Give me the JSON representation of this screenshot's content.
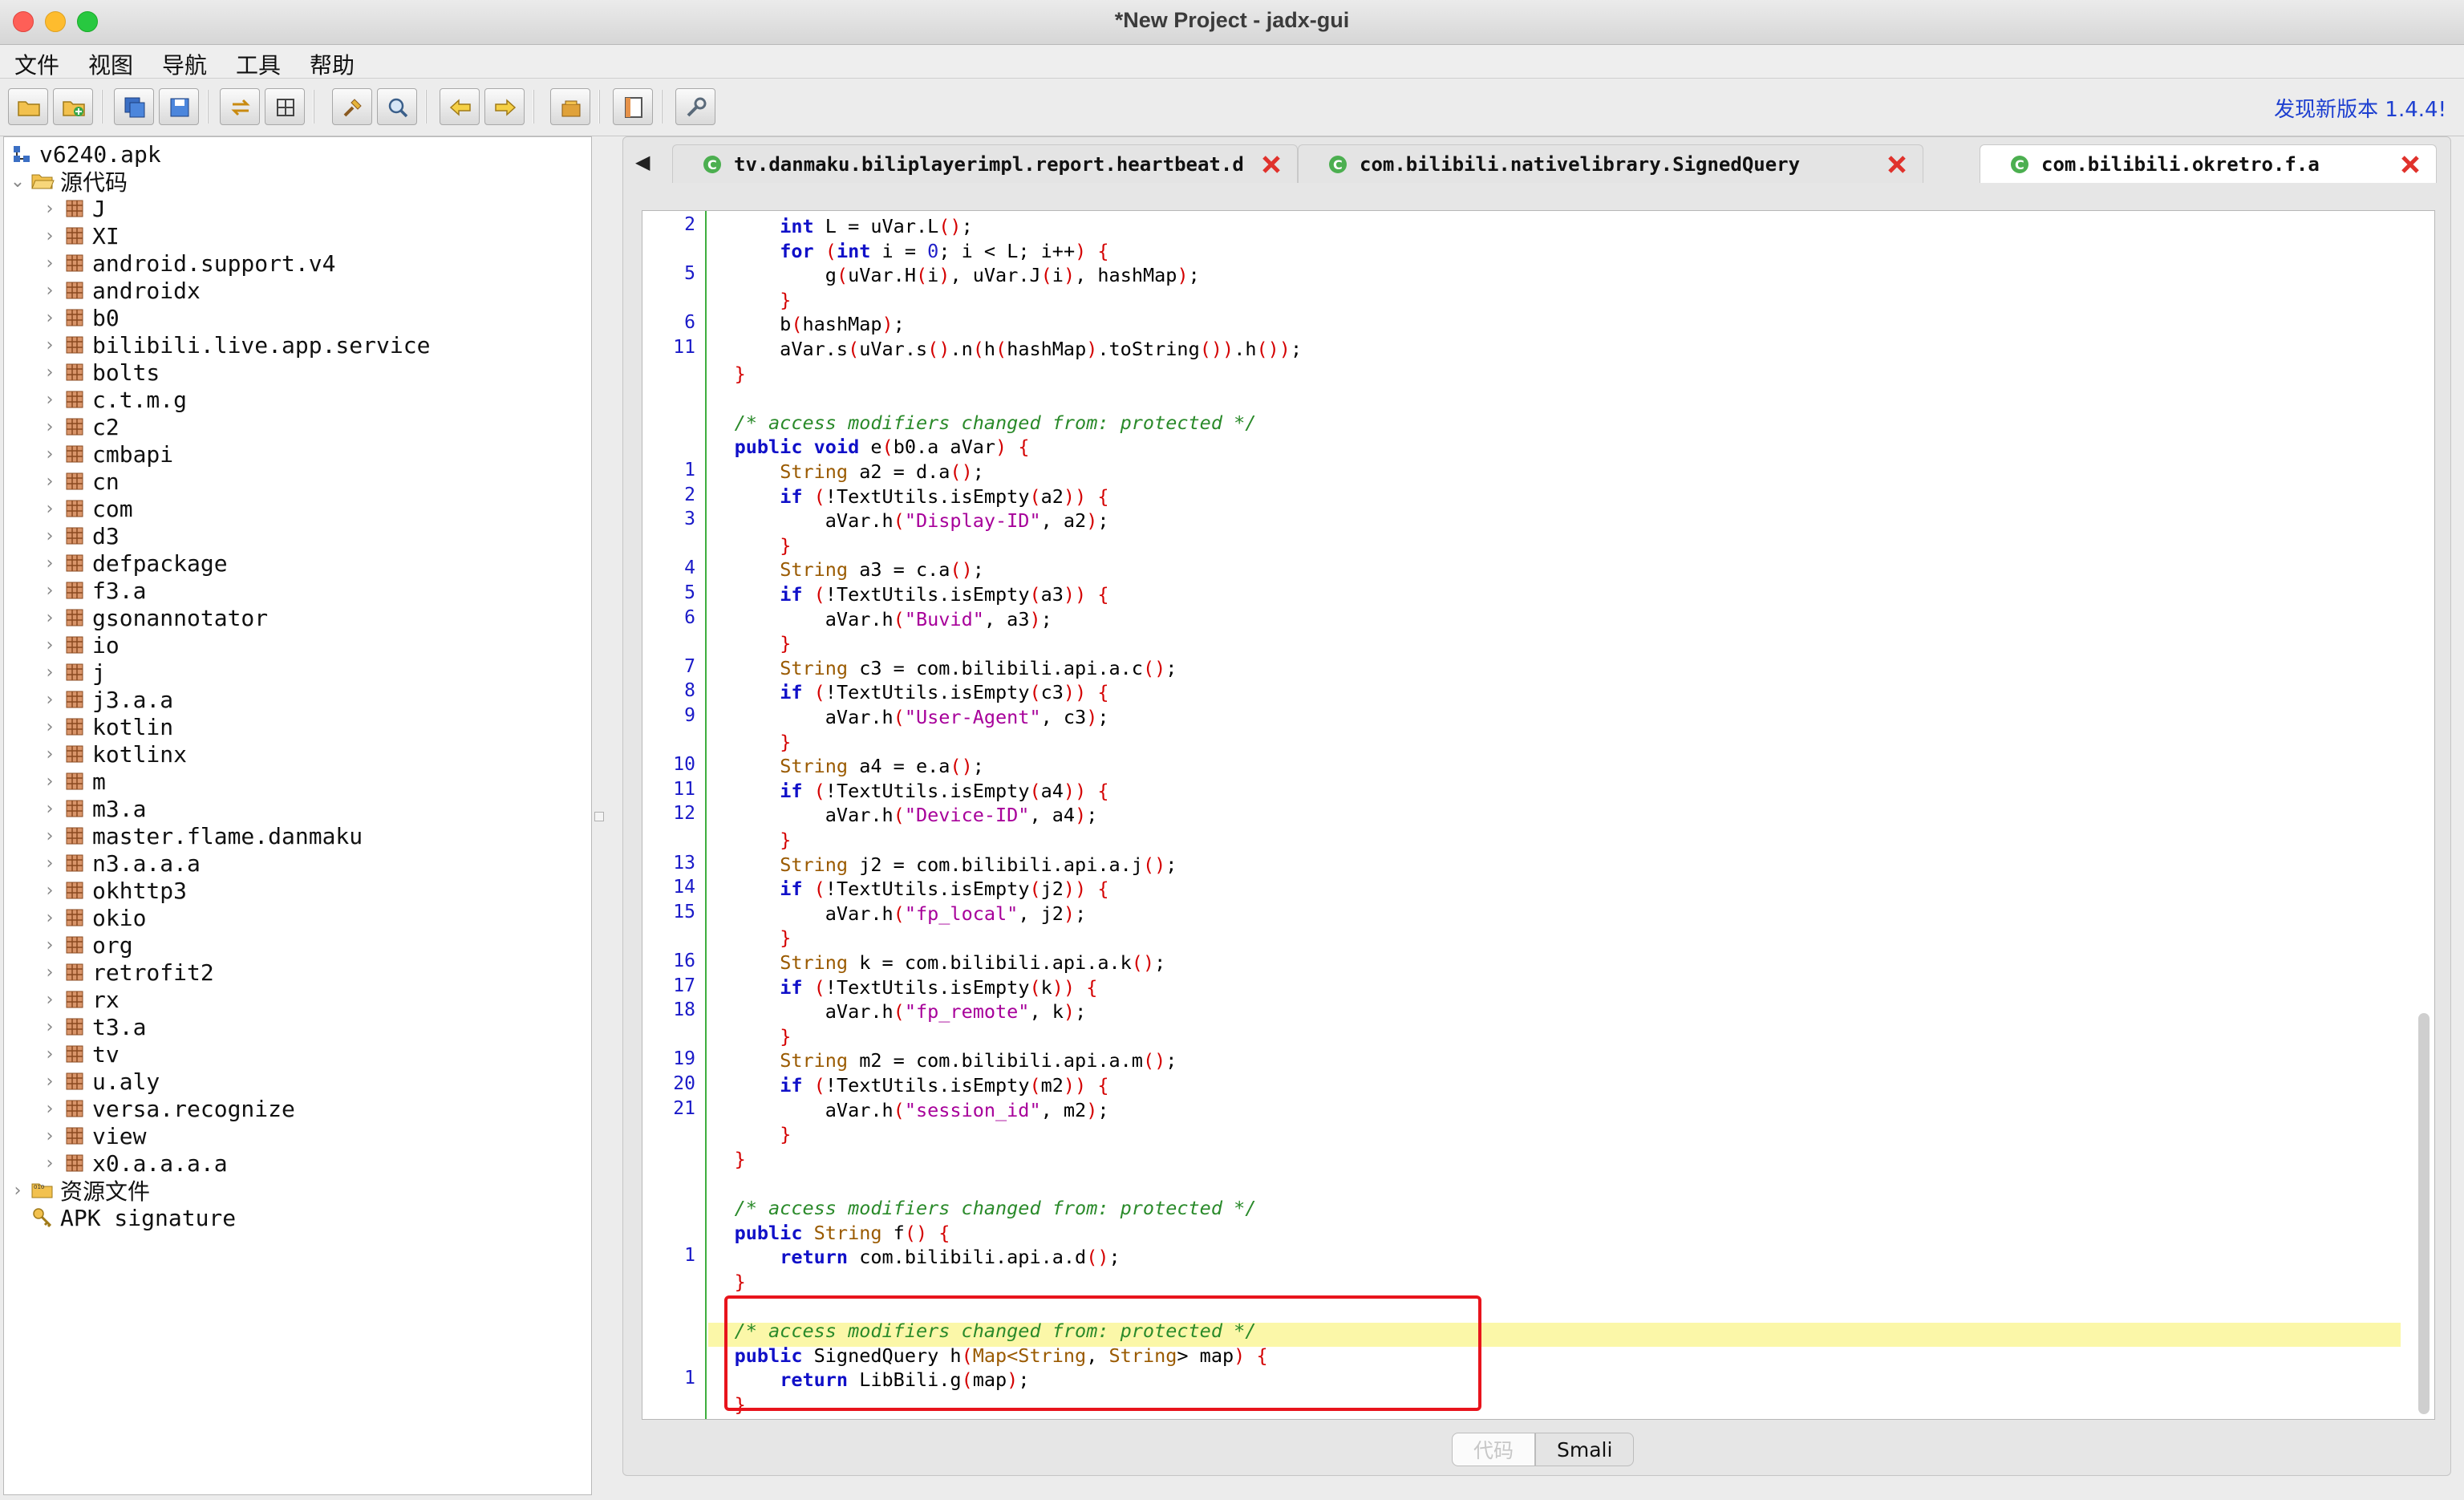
{
  "window": {
    "title": "*New Project - jadx-gui"
  },
  "menu": [
    "文件",
    "视图",
    "导航",
    "工具",
    "帮助"
  ],
  "toolbar": {
    "buttons": [
      "open-file-icon",
      "add-files-icon",
      "save-all-icon",
      "export-icon",
      "sync-icon",
      "flatten-icon",
      "search-icon",
      "find-class-icon",
      "back-icon",
      "forward-icon",
      "decompile-icon",
      "log-icon",
      "preferences-icon"
    ],
    "update_text": "发现新版本 1.4.4!"
  },
  "tree": {
    "root": "v6240.apk",
    "source_folder": "源代码",
    "packages": [
      "J",
      "XI",
      "android.support.v4",
      "androidx",
      "b0",
      "bilibili.live.app.service",
      "bolts",
      "c.t.m.g",
      "c2",
      "cmbapi",
      "cn",
      "com",
      "d3",
      "defpackage",
      "f3.a",
      "gsonannotator",
      "io",
      "j",
      "j3.a.a",
      "kotlin",
      "kotlinx",
      "m",
      "m3.a",
      "master.flame.danmaku",
      "n3.a.a.a",
      "okhttp3",
      "okio",
      "org",
      "retrofit2",
      "rx",
      "t3.a",
      "tv",
      "u.aly",
      "versa.recognize",
      "view",
      "x0.a.a.a.a"
    ],
    "resources": "资源文件",
    "signature": "APK signature"
  },
  "tabs": [
    {
      "label": "tv.danmaku.biliplayerimpl.report.heartbeat.d",
      "active": false
    },
    {
      "label": "com.bilibili.nativelibrary.SignedQuery",
      "active": false
    },
    {
      "label": "com.bilibili.okretro.f.a",
      "active": true
    }
  ],
  "code": {
    "line_numbers": [
      {
        "row": 0,
        "n": "2"
      },
      {
        "row": 2,
        "n": "5"
      },
      {
        "row": 4,
        "n": "6"
      },
      {
        "row": 5,
        "n": "11"
      },
      {
        "row": 10,
        "n": "1"
      },
      {
        "row": 11,
        "n": "2"
      },
      {
        "row": 12,
        "n": "3"
      },
      {
        "row": 14,
        "n": "4"
      },
      {
        "row": 15,
        "n": "5"
      },
      {
        "row": 16,
        "n": "6"
      },
      {
        "row": 18,
        "n": "7"
      },
      {
        "row": 19,
        "n": "8"
      },
      {
        "row": 20,
        "n": "9"
      },
      {
        "row": 22,
        "n": "10"
      },
      {
        "row": 23,
        "n": "11"
      },
      {
        "row": 24,
        "n": "12"
      },
      {
        "row": 26,
        "n": "13"
      },
      {
        "row": 27,
        "n": "14"
      },
      {
        "row": 28,
        "n": "15"
      },
      {
        "row": 30,
        "n": "16"
      },
      {
        "row": 31,
        "n": "17"
      },
      {
        "row": 32,
        "n": "18"
      },
      {
        "row": 34,
        "n": "19"
      },
      {
        "row": 35,
        "n": "20"
      },
      {
        "row": 36,
        "n": "21"
      },
      {
        "row": 42,
        "n": "1"
      },
      {
        "row": 47,
        "n": "1"
      }
    ],
    "lines": [
      [
        [
          "        ",
          ""
        ],
        [
          "int",
          "kw"
        ],
        [
          " L = uVar.L",
          ""
        ],
        [
          "()",
          "br"
        ],
        [
          ";",
          ""
        ]
      ],
      [
        [
          "        ",
          ""
        ],
        [
          "for",
          "kw"
        ],
        [
          " ",
          ""
        ],
        [
          "(",
          "br"
        ],
        [
          "int",
          "kw"
        ],
        [
          " i = ",
          ""
        ],
        [
          "0",
          "nm"
        ],
        [
          "; i < L; i++",
          ""
        ],
        [
          ")",
          "br"
        ],
        [
          " ",
          ""
        ],
        [
          "{",
          "br"
        ]
      ],
      [
        [
          "            g",
          ""
        ],
        [
          "(",
          "br"
        ],
        [
          "uVar.H",
          ""
        ],
        [
          "(",
          "br"
        ],
        [
          "i",
          ""
        ],
        [
          ")",
          "br"
        ],
        [
          ", uVar.J",
          ""
        ],
        [
          "(",
          "br"
        ],
        [
          "i",
          ""
        ],
        [
          ")",
          "br"
        ],
        [
          ", hashMap",
          ""
        ],
        [
          ")",
          "br"
        ],
        [
          ";",
          ""
        ]
      ],
      [
        [
          "        ",
          ""
        ],
        [
          "}",
          "br"
        ]
      ],
      [
        [
          "        b",
          ""
        ],
        [
          "(",
          "br"
        ],
        [
          "hashMap",
          ""
        ],
        [
          ")",
          "br"
        ],
        [
          ";",
          ""
        ]
      ],
      [
        [
          "        aVar.s",
          ""
        ],
        [
          "(",
          "br"
        ],
        [
          "uVar.s",
          ""
        ],
        [
          "()",
          "br"
        ],
        [
          ".n",
          ""
        ],
        [
          "(",
          "br"
        ],
        [
          "h",
          ""
        ],
        [
          "(",
          "br"
        ],
        [
          "hashMap",
          ""
        ],
        [
          ")",
          "br"
        ],
        [
          ".toString",
          ""
        ],
        [
          "())",
          "br"
        ],
        [
          ".h",
          ""
        ],
        [
          "())",
          "br"
        ],
        [
          ";",
          ""
        ]
      ],
      [
        [
          "    ",
          ""
        ],
        [
          "}",
          "br"
        ]
      ],
      [
        [
          "",
          ""
        ]
      ],
      [
        [
          "    ",
          ""
        ],
        [
          "/* access modifiers changed from: protected */",
          "cm"
        ]
      ],
      [
        [
          "    ",
          ""
        ],
        [
          "public",
          "kw"
        ],
        [
          " ",
          ""
        ],
        [
          "void",
          "kw"
        ],
        [
          " e",
          ""
        ],
        [
          "(",
          "br"
        ],
        [
          "b0.a aVar",
          ""
        ],
        [
          ")",
          "br"
        ],
        [
          " ",
          ""
        ],
        [
          "{",
          "br"
        ]
      ],
      [
        [
          "        ",
          ""
        ],
        [
          "String",
          "ty"
        ],
        [
          " a2 = d.a",
          ""
        ],
        [
          "()",
          "br"
        ],
        [
          ";",
          ""
        ]
      ],
      [
        [
          "        ",
          ""
        ],
        [
          "if",
          "kw"
        ],
        [
          " ",
          ""
        ],
        [
          "(",
          "br"
        ],
        [
          "!TextUtils.isEmpty",
          ""
        ],
        [
          "(",
          "br"
        ],
        [
          "a2",
          ""
        ],
        [
          ")",
          "br"
        ],
        [
          ")",
          "br"
        ],
        [
          " ",
          ""
        ],
        [
          "{",
          "br"
        ]
      ],
      [
        [
          "            aVar.h",
          ""
        ],
        [
          "(",
          "br"
        ],
        [
          "\"Display-ID\"",
          "st"
        ],
        [
          ", a2",
          ""
        ],
        [
          ")",
          "br"
        ],
        [
          ";",
          ""
        ]
      ],
      [
        [
          "        ",
          ""
        ],
        [
          "}",
          "br"
        ]
      ],
      [
        [
          "        ",
          ""
        ],
        [
          "String",
          "ty"
        ],
        [
          " a3 = c.a",
          ""
        ],
        [
          "()",
          "br"
        ],
        [
          ";",
          ""
        ]
      ],
      [
        [
          "        ",
          ""
        ],
        [
          "if",
          "kw"
        ],
        [
          " ",
          ""
        ],
        [
          "(",
          "br"
        ],
        [
          "!TextUtils.isEmpty",
          ""
        ],
        [
          "(",
          "br"
        ],
        [
          "a3",
          ""
        ],
        [
          ")",
          "br"
        ],
        [
          ")",
          "br"
        ],
        [
          " ",
          ""
        ],
        [
          "{",
          "br"
        ]
      ],
      [
        [
          "            aVar.h",
          ""
        ],
        [
          "(",
          "br"
        ],
        [
          "\"Buvid\"",
          "st"
        ],
        [
          ", a3",
          ""
        ],
        [
          ")",
          "br"
        ],
        [
          ";",
          ""
        ]
      ],
      [
        [
          "        ",
          ""
        ],
        [
          "}",
          "br"
        ]
      ],
      [
        [
          "        ",
          ""
        ],
        [
          "String",
          "ty"
        ],
        [
          " c3 = com.bilibili.api.a.c",
          ""
        ],
        [
          "()",
          "br"
        ],
        [
          ";",
          ""
        ]
      ],
      [
        [
          "        ",
          ""
        ],
        [
          "if",
          "kw"
        ],
        [
          " ",
          ""
        ],
        [
          "(",
          "br"
        ],
        [
          "!TextUtils.isEmpty",
          ""
        ],
        [
          "(",
          "br"
        ],
        [
          "c3",
          ""
        ],
        [
          ")",
          "br"
        ],
        [
          ")",
          "br"
        ],
        [
          " ",
          ""
        ],
        [
          "{",
          "br"
        ]
      ],
      [
        [
          "            aVar.h",
          ""
        ],
        [
          "(",
          "br"
        ],
        [
          "\"User-Agent\"",
          "st"
        ],
        [
          ", c3",
          ""
        ],
        [
          ")",
          "br"
        ],
        [
          ";",
          ""
        ]
      ],
      [
        [
          "        ",
          ""
        ],
        [
          "}",
          "br"
        ]
      ],
      [
        [
          "        ",
          ""
        ],
        [
          "String",
          "ty"
        ],
        [
          " a4 = e.a",
          ""
        ],
        [
          "()",
          "br"
        ],
        [
          ";",
          ""
        ]
      ],
      [
        [
          "        ",
          ""
        ],
        [
          "if",
          "kw"
        ],
        [
          " ",
          ""
        ],
        [
          "(",
          "br"
        ],
        [
          "!TextUtils.isEmpty",
          ""
        ],
        [
          "(",
          "br"
        ],
        [
          "a4",
          ""
        ],
        [
          ")",
          "br"
        ],
        [
          ")",
          "br"
        ],
        [
          " ",
          ""
        ],
        [
          "{",
          "br"
        ]
      ],
      [
        [
          "            aVar.h",
          ""
        ],
        [
          "(",
          "br"
        ],
        [
          "\"Device-ID\"",
          "st"
        ],
        [
          ", a4",
          ""
        ],
        [
          ")",
          "br"
        ],
        [
          ";",
          ""
        ]
      ],
      [
        [
          "        ",
          ""
        ],
        [
          "}",
          "br"
        ]
      ],
      [
        [
          "        ",
          ""
        ],
        [
          "String",
          "ty"
        ],
        [
          " j2 = com.bilibili.api.a.j",
          ""
        ],
        [
          "()",
          "br"
        ],
        [
          ";",
          ""
        ]
      ],
      [
        [
          "        ",
          ""
        ],
        [
          "if",
          "kw"
        ],
        [
          " ",
          ""
        ],
        [
          "(",
          "br"
        ],
        [
          "!TextUtils.isEmpty",
          ""
        ],
        [
          "(",
          "br"
        ],
        [
          "j2",
          ""
        ],
        [
          ")",
          "br"
        ],
        [
          ")",
          "br"
        ],
        [
          " ",
          ""
        ],
        [
          "{",
          "br"
        ]
      ],
      [
        [
          "            aVar.h",
          ""
        ],
        [
          "(",
          "br"
        ],
        [
          "\"fp_local\"",
          "st"
        ],
        [
          ", j2",
          ""
        ],
        [
          ")",
          "br"
        ],
        [
          ";",
          ""
        ]
      ],
      [
        [
          "        ",
          ""
        ],
        [
          "}",
          "br"
        ]
      ],
      [
        [
          "        ",
          ""
        ],
        [
          "String",
          "ty"
        ],
        [
          " k = com.bilibili.api.a.k",
          ""
        ],
        [
          "()",
          "br"
        ],
        [
          ";",
          ""
        ]
      ],
      [
        [
          "        ",
          ""
        ],
        [
          "if",
          "kw"
        ],
        [
          " ",
          ""
        ],
        [
          "(",
          "br"
        ],
        [
          "!TextUtils.isEmpty",
          ""
        ],
        [
          "(",
          "br"
        ],
        [
          "k",
          ""
        ],
        [
          ")",
          "br"
        ],
        [
          ")",
          "br"
        ],
        [
          " ",
          ""
        ],
        [
          "{",
          "br"
        ]
      ],
      [
        [
          "            aVar.h",
          ""
        ],
        [
          "(",
          "br"
        ],
        [
          "\"fp_remote\"",
          "st"
        ],
        [
          ", k",
          ""
        ],
        [
          ")",
          "br"
        ],
        [
          ";",
          ""
        ]
      ],
      [
        [
          "        ",
          ""
        ],
        [
          "}",
          "br"
        ]
      ],
      [
        [
          "        ",
          ""
        ],
        [
          "String",
          "ty"
        ],
        [
          " m2 = com.bilibili.api.a.m",
          ""
        ],
        [
          "()",
          "br"
        ],
        [
          ";",
          ""
        ]
      ],
      [
        [
          "        ",
          ""
        ],
        [
          "if",
          "kw"
        ],
        [
          " ",
          ""
        ],
        [
          "(",
          "br"
        ],
        [
          "!TextUtils.isEmpty",
          ""
        ],
        [
          "(",
          "br"
        ],
        [
          "m2",
          ""
        ],
        [
          ")",
          "br"
        ],
        [
          ")",
          "br"
        ],
        [
          " ",
          ""
        ],
        [
          "{",
          "br"
        ]
      ],
      [
        [
          "            aVar.h",
          ""
        ],
        [
          "(",
          "br"
        ],
        [
          "\"session_id\"",
          "st"
        ],
        [
          ", m2",
          ""
        ],
        [
          ")",
          "br"
        ],
        [
          ";",
          ""
        ]
      ],
      [
        [
          "        ",
          ""
        ],
        [
          "}",
          "br"
        ]
      ],
      [
        [
          "    ",
          ""
        ],
        [
          "}",
          "br"
        ]
      ],
      [
        [
          "",
          ""
        ]
      ],
      [
        [
          "    ",
          ""
        ],
        [
          "/* access modifiers changed from: protected */",
          "cm"
        ]
      ],
      [
        [
          "    ",
          ""
        ],
        [
          "public",
          "kw"
        ],
        [
          " ",
          ""
        ],
        [
          "String",
          "ty"
        ],
        [
          " f",
          ""
        ],
        [
          "()",
          "br"
        ],
        [
          " ",
          ""
        ],
        [
          "{",
          "br"
        ]
      ],
      [
        [
          "        ",
          ""
        ],
        [
          "return",
          "kw"
        ],
        [
          " com.bilibili.api.a.d",
          ""
        ],
        [
          "()",
          "br"
        ],
        [
          ";",
          ""
        ]
      ],
      [
        [
          "    ",
          ""
        ],
        [
          "}",
          "br"
        ]
      ],
      [
        [
          "",
          ""
        ]
      ],
      [
        [
          "    ",
          ""
        ],
        [
          "/* access modifiers changed from: protected */",
          "cm"
        ]
      ],
      [
        [
          "    ",
          ""
        ],
        [
          "public",
          "kw"
        ],
        [
          " SignedQuery h",
          ""
        ],
        [
          "(",
          "br"
        ],
        [
          "Map<String",
          "ty"
        ],
        [
          ", ",
          ""
        ],
        [
          "String",
          "ty"
        ],
        [
          "> map",
          ""
        ],
        [
          ")",
          "br"
        ],
        [
          " ",
          ""
        ],
        [
          "{",
          "br"
        ]
      ],
      [
        [
          "        ",
          ""
        ],
        [
          "return",
          "kw"
        ],
        [
          " LibBili.g",
          ""
        ],
        [
          "(",
          "br"
        ],
        [
          "map",
          ""
        ],
        [
          ")",
          "br"
        ],
        [
          ";",
          ""
        ]
      ],
      [
        [
          "    ",
          ""
        ],
        [
          "}",
          "br"
        ]
      ],
      [
        [
          "",
          ""
        ],
        [
          "}",
          "br"
        ]
      ]
    ]
  },
  "bottom_tabs": [
    "代码",
    "Smali"
  ]
}
